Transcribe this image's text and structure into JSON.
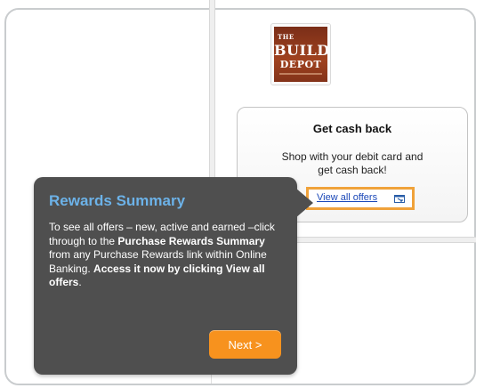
{
  "logo": {
    "the": "THE",
    "build": "BUILD",
    "depot": "DEPOT"
  },
  "cash_back": {
    "title": "Get cash back",
    "text_line1": "Shop with your debit card and",
    "text_line2": "get cash back!",
    "link_label": "View all offers",
    "link_icon": "external-window-icon"
  },
  "tooltip": {
    "title": "Rewards Summary",
    "body_part1": "To see all offers – new, active and earned –click through to the ",
    "body_bold1": "Purchase Rewards Summary",
    "body_part2": " from any Purchase Rewards link within Online Banking. ",
    "body_bold2": "Access it now by clicking View all offers",
    "body_part3": ".",
    "next_label": "Next >"
  },
  "colors": {
    "accent_orange": "#f7921e",
    "tooltip_bg": "#4f4f4f",
    "tooltip_title": "#6cb2e8",
    "link_blue": "#1b48b8"
  }
}
